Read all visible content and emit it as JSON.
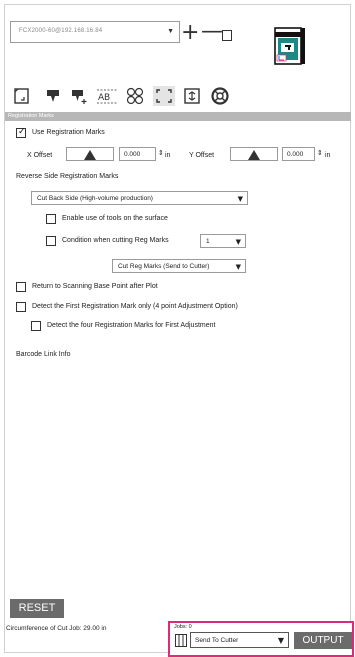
{
  "device": {
    "selected": "FCX2000-60@192.168.16.84"
  },
  "toolbar": {
    "items": [
      {
        "name": "page-setup-icon"
      },
      {
        "name": "tool-icon"
      },
      {
        "name": "tool-add-icon"
      },
      {
        "name": "text-aab-icon"
      },
      {
        "name": "group-icon"
      },
      {
        "name": "registration-marks-icon"
      },
      {
        "name": "settings-icon"
      },
      {
        "name": "support-icon"
      }
    ]
  },
  "section": {
    "title": "Registration Marks"
  },
  "registration": {
    "use_marks_label": "Use Registration Marks",
    "use_marks_checked": true,
    "x_offset_label": "X Offset",
    "x_offset_value": "0.000",
    "x_unit": "in",
    "y_offset_label": "Y Offset",
    "y_offset_value": "0.000",
    "y_unit": "in"
  },
  "reverse": {
    "title": "Reverse Side Registration Marks",
    "mode": "Cut Back Side (High-volume production)",
    "enable_tools_label": "Enable use of tools on the surface",
    "condition_label": "Condition when cutting Reg Marks",
    "condition_value": "1",
    "cut_reg_marks": "Cut Reg Marks (Send to Cutter)"
  },
  "options": {
    "return_label": "Return to Scanning Base Point after Plot",
    "detect_first_label": "Detect the First Registration Mark only (4 point Adjustment Option)",
    "detect_four_label": "Detect the four Registration Marks for First Adjustment"
  },
  "barcode": {
    "label": "Barcode Link Info"
  },
  "footer": {
    "reset_label": "RESET",
    "circumference": "Circumference of Cut Job: 29.00 in",
    "jobs": "Jobs: 0",
    "send_to": "Send To Cutter",
    "output_label": "OUTPUT"
  },
  "colors": {
    "accent": "#e0297a",
    "button": "#6b6b6b",
    "section_bar": "#b7b7b7"
  }
}
